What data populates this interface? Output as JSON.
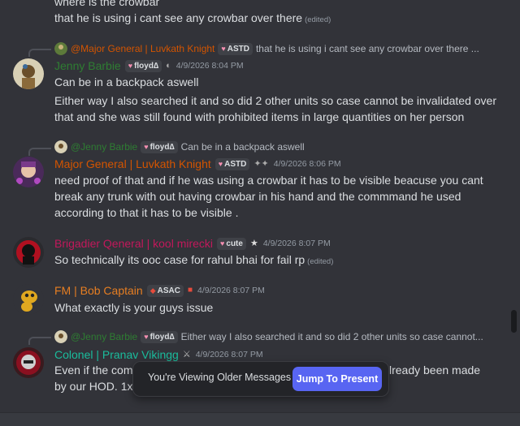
{
  "messages": [
    {
      "continuation": true,
      "top_partial_text": "where is the crowbar",
      "text": "that he is using i cant see any crowbar over there",
      "edited": "(edited)"
    },
    {
      "reply": {
        "name": "@Major General | Luvkath  Knight",
        "tag": "ASTD",
        "text": "that he is using i cant see any crowbar over there ..."
      },
      "author": "Jenny Barbie",
      "tag": "floyd∆",
      "timestamp": "4/9/2026 8:04 PM",
      "lines": [
        "Can be in a backpack aswell",
        "Either way I also searched it and so did 2 other units so case cannot be invalidated over",
        "that and she was still found with prohibited items in large quantities on her person"
      ]
    },
    {
      "reply": {
        "name": "@Jenny Barbie",
        "tag": "floyd∆",
        "text": "Can be in a backpack aswell"
      },
      "author": "Major General | Luvkath  Knight",
      "tag": "ASTD",
      "timestamp": "4/9/2026 8:06 PM",
      "lines": [
        "need proof of that and if he was using a crowbar it has to be visible beacuse you cant",
        "break any trunk with out having crowbar in his hand and the commmand he used",
        "according to that it has to be visible ."
      ]
    },
    {
      "author": "Brigadier Qeneral | kool mirecki",
      "tag": "cute",
      "timestamp": "4/9/2026 8:07 PM",
      "lines": [
        "So technically its ooc case for rahul bhai for fail rp"
      ],
      "edited": "(edited)"
    },
    {
      "author": "FM | Bob Captain",
      "tag": "ASAC",
      "timestamp": "4/9/2026 8:07 PM",
      "lines": [
        "What exactly is your guys issue"
      ]
    },
    {
      "reply": {
        "name": "@Jenny Barbie",
        "tag": "floyd∆",
        "text": "Either way I also searched it and so did 2 other units so case cannot..."
      },
      "author": "Colonel | Pranav Vikingg",
      "timestamp": "4/9/2026 8:07 PM",
      "line1_left": "Even if the comm",
      "line1_right": "lready been made",
      "line2_left": "by our HOD. 1x s"
    }
  ],
  "toast": {
    "message": "You're Viewing Older Messages",
    "button": "Jump To Present"
  },
  "colors": {
    "background": "#323339",
    "jenny": "#2e7d32",
    "luvkath": "#d35400",
    "kool": "#c2185b",
    "bob": "#e67e22",
    "pranav": "#1abc9c",
    "blurple": "#5865f2"
  }
}
